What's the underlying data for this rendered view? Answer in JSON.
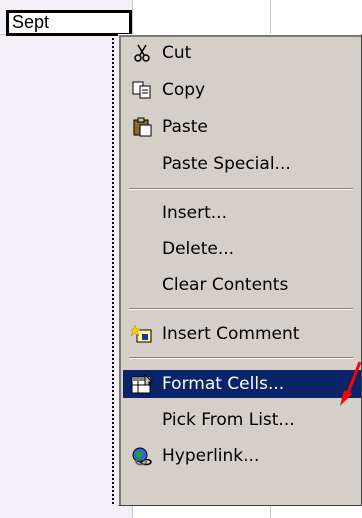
{
  "cell": {
    "value": "Sept"
  },
  "menu": {
    "items": [
      {
        "label": "Cut",
        "icon": "scissors-icon"
      },
      {
        "label": "Copy",
        "icon": "copy-icon"
      },
      {
        "label": "Paste",
        "icon": "paste-icon"
      },
      {
        "label": "Paste Special..."
      },
      {
        "label": "Insert..."
      },
      {
        "label": "Delete..."
      },
      {
        "label": "Clear Contents"
      },
      {
        "label": "Insert Comment",
        "icon": "comment-icon"
      },
      {
        "label": "Format Cells...",
        "icon": "format-cells-icon",
        "highlighted": true
      },
      {
        "label": "Pick From List..."
      },
      {
        "label": "Hyperlink...",
        "icon": "hyperlink-icon"
      }
    ]
  },
  "colors": {
    "menu_bg": "#d4d0c8",
    "highlight": "#0a246a",
    "arrow": "#ff0000"
  }
}
